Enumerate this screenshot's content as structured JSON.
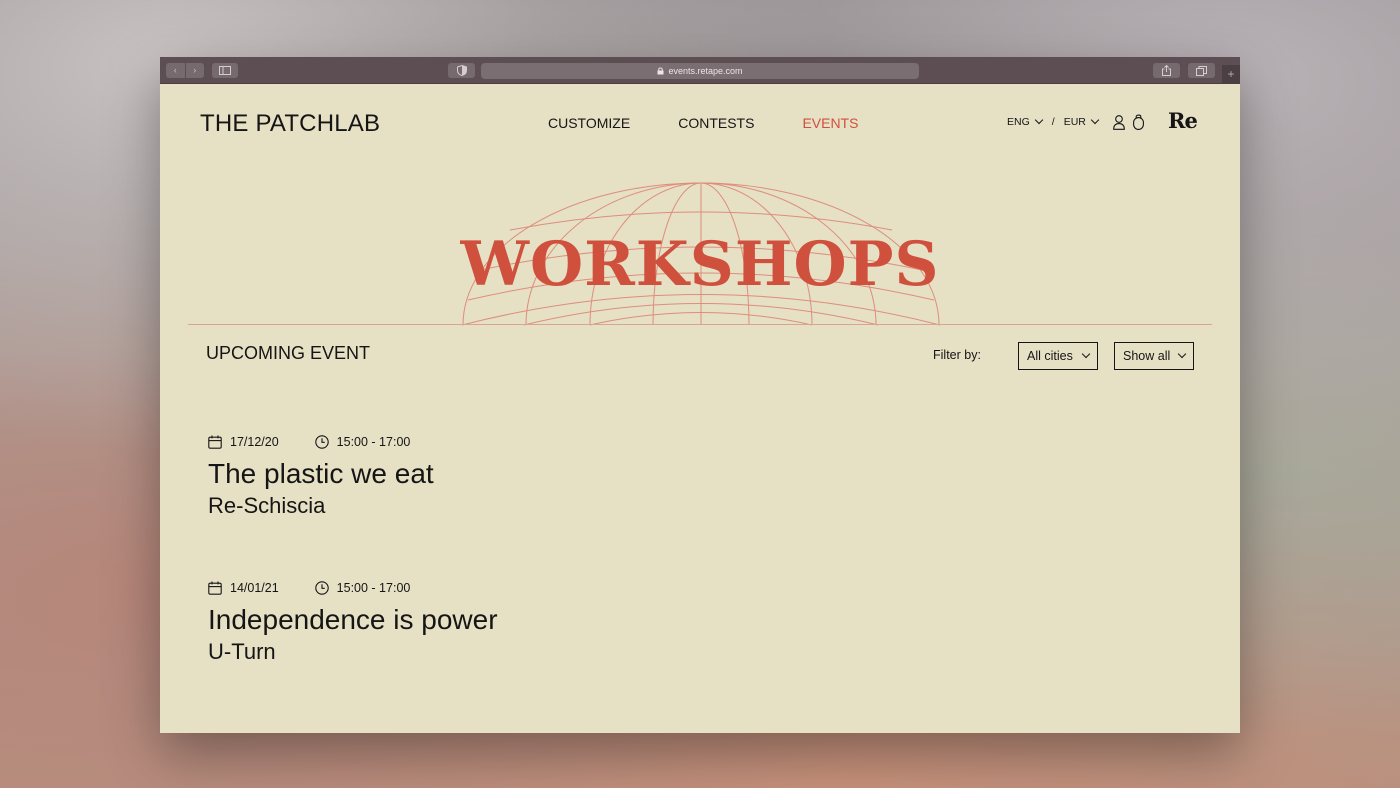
{
  "browser": {
    "url": "events.retape.com",
    "plus_label": "+"
  },
  "header": {
    "logo": "THE PATCHLAB",
    "nav": [
      {
        "label": "CUSTOMIZE"
      },
      {
        "label": "CONTESTS"
      },
      {
        "label": "EVENTS",
        "active": true
      }
    ],
    "language": "ENG",
    "separator": "/",
    "currency": "EUR",
    "brand_mark": "Re"
  },
  "hero": {
    "title": "WORKSHOPS"
  },
  "section": {
    "title": "UPCOMING EVENT",
    "filter_label": "Filter by:",
    "city_filter": "All cities",
    "show_filter": "Show all"
  },
  "events": [
    {
      "date": "17/12/20",
      "time": "15:00 - 17:00",
      "title": "The plastic we eat",
      "organizer": "Re-Schiscia"
    },
    {
      "date": "14/01/21",
      "time": "15:00 - 17:00",
      "title": "Independence is power",
      "organizer": "U-Turn"
    }
  ],
  "colors": {
    "page_bg": "#e6e0c5",
    "accent": "#d0503e",
    "text": "#151515",
    "chrome": "#5c4e52"
  },
  "icons": {
    "date": "calendar-icon",
    "time": "clock-icon",
    "account": "user-icon",
    "bag": "bag-icon"
  }
}
